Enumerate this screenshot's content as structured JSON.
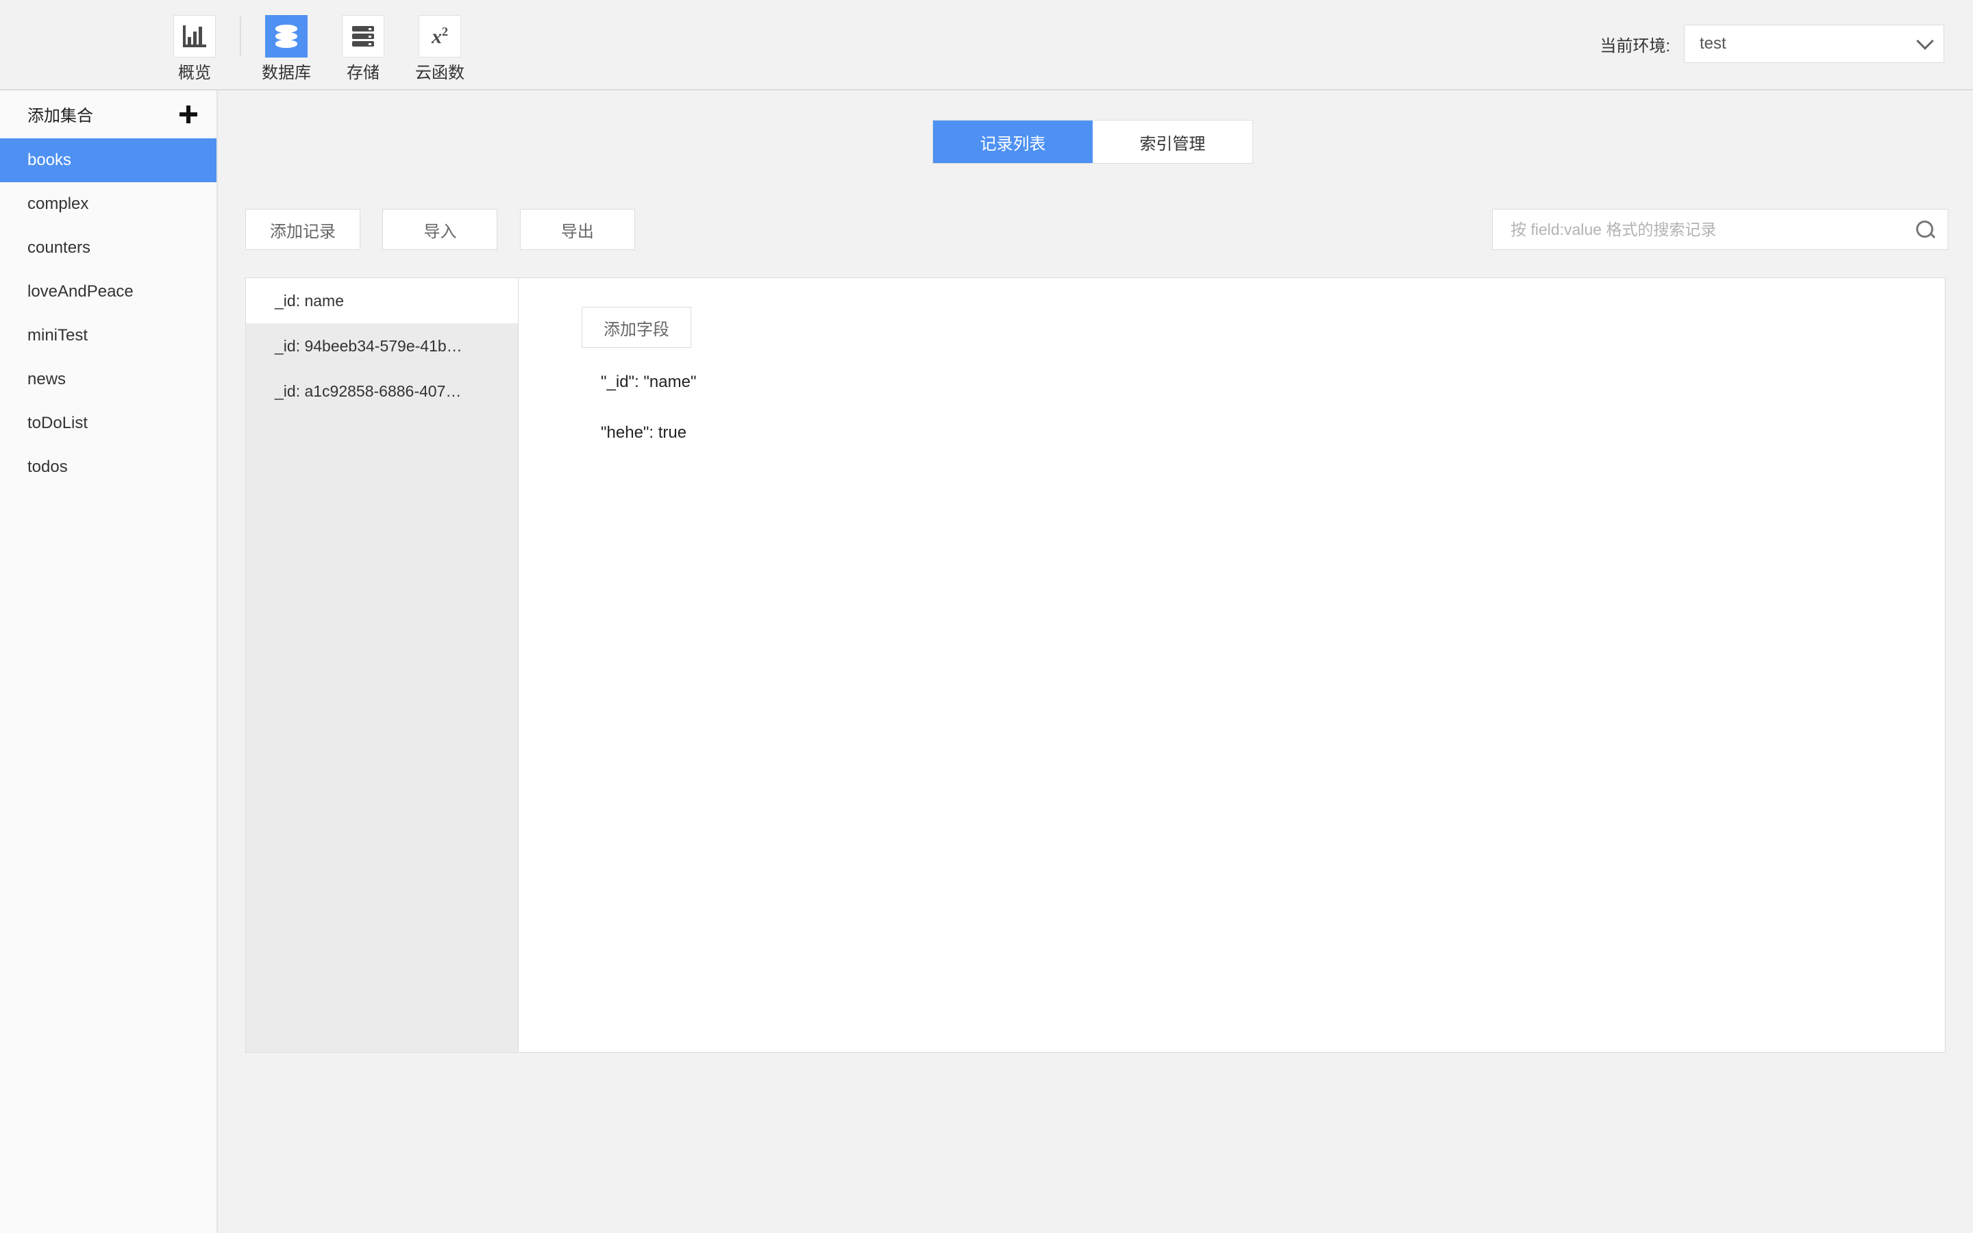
{
  "header": {
    "nav": [
      {
        "label": "概览",
        "icon": "bar-chart-icon",
        "active": false
      },
      {
        "label": "数据库",
        "icon": "database-icon",
        "active": true
      },
      {
        "label": "存储",
        "icon": "server-storage-icon",
        "active": false
      },
      {
        "label": "云函数",
        "icon": "function-x-squared-icon",
        "active": false
      }
    ],
    "env_label": "当前环境:",
    "env_value": "test"
  },
  "sidebar": {
    "add_collection_label": "添加集合",
    "collections": [
      {
        "label": "books",
        "active": true
      },
      {
        "label": "complex",
        "active": false
      },
      {
        "label": "counters",
        "active": false
      },
      {
        "label": "loveAndPeace",
        "active": false
      },
      {
        "label": "miniTest",
        "active": false
      },
      {
        "label": "news",
        "active": false
      },
      {
        "label": "toDoList",
        "active": false
      },
      {
        "label": "todos",
        "active": false
      }
    ]
  },
  "main": {
    "tabs": [
      {
        "label": "记录列表",
        "active": true
      },
      {
        "label": "索引管理",
        "active": false
      }
    ],
    "toolbar": {
      "add_record_label": "添加记录",
      "import_label": "导入",
      "export_label": "导出",
      "search_placeholder": "按 field:value 格式的搜索记录",
      "search_value": ""
    },
    "records": [
      {
        "label": "_id: name",
        "selected": true
      },
      {
        "label": "_id: 94beeb34-579e-41b…",
        "selected": false
      },
      {
        "label": "_id: a1c92858-6886-407…",
        "selected": false
      }
    ],
    "detail": {
      "add_field_label": "添加字段",
      "fields": [
        "\"_id\": \"name\"",
        "\"hehe\": true"
      ]
    }
  },
  "colors": {
    "accent": "#4e91f2",
    "page_bg": "#f2f2f2",
    "sidebar_bg": "#fafafa",
    "panel_bg": "#ffffff",
    "record_list_bg": "#ebebeb",
    "border": "#dcdcdc"
  }
}
